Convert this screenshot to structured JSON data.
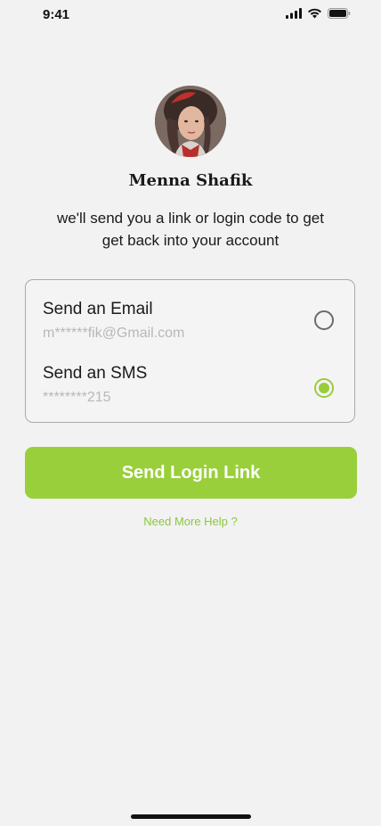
{
  "status_bar": {
    "time": "9:41"
  },
  "user": {
    "name": "Menna Shafik"
  },
  "info_text": "we'll send you a link or login code to get\nget back into  your account",
  "options": {
    "email": {
      "title": "Send an Email",
      "masked": "m******fik@Gmail.com",
      "selected": false
    },
    "sms": {
      "title": "Send an SMS",
      "masked": "********215",
      "selected": true
    }
  },
  "primary_button": {
    "label": "Send Login Link"
  },
  "help_link": {
    "label": "Need More Help ?"
  },
  "colors": {
    "accent": "#99cf3a",
    "link": "#8cc63f",
    "background": "#f2f2f2"
  },
  "icons": [
    "signal-icon",
    "wifi-icon",
    "battery-icon"
  ]
}
